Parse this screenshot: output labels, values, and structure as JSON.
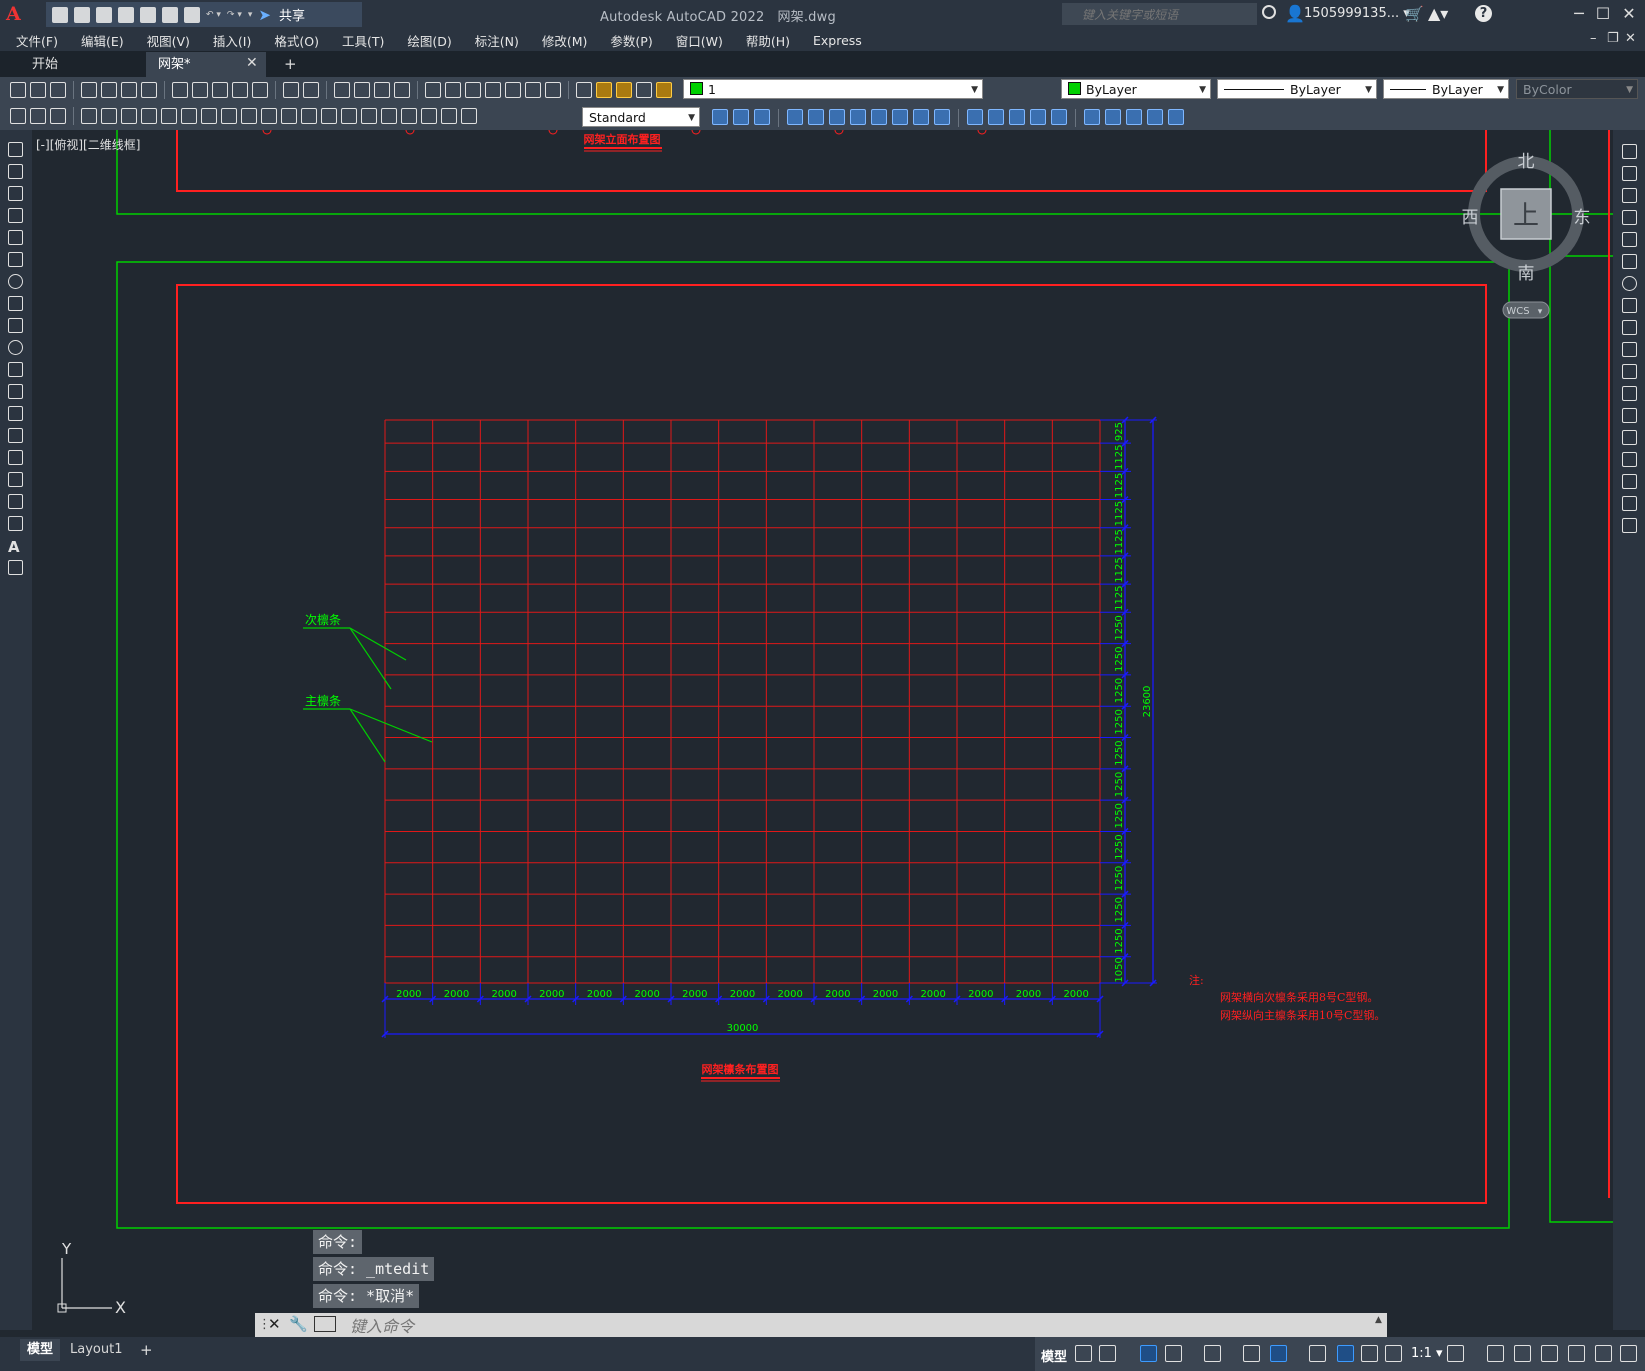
{
  "title_bar": {
    "app_logo": "A",
    "share_label": "共享",
    "app_title": "Autodesk AutoCAD 2022",
    "file_name": "网架.dwg",
    "search_placeholder": "键入关键字或短语",
    "user_name": "1505999135...",
    "help": "?"
  },
  "menu": [
    "文件(F)",
    "编辑(E)",
    "视图(V)",
    "插入(I)",
    "格式(O)",
    "工具(T)",
    "绘图(D)",
    "标注(N)",
    "修改(M)",
    "参数(P)",
    "窗口(W)",
    "帮助(H)",
    "Express"
  ],
  "tabs": {
    "start": "开始",
    "drawing": "网架*"
  },
  "toolbar": {
    "layer_name": "1",
    "color": "ByLayer",
    "linetype": "ByLayer",
    "lineweight": "ByLayer",
    "plotstyle": "ByColor",
    "text_style": "Standard"
  },
  "viewport_label": "[-][俯视][二维线框]",
  "viewcube": {
    "north": "北",
    "south": "南",
    "east": "东",
    "west": "西",
    "top": "上",
    "wcs": "WCS"
  },
  "ucs": {
    "x": "X",
    "y": "Y"
  },
  "drawing": {
    "upper_title": "网架立面布置图",
    "main_title": "网架檩条布置图",
    "label_secondary": "次檩条",
    "label_main": "主檩条",
    "col_dims": [
      "2000",
      "2000",
      "2000",
      "2000",
      "2000",
      "2000",
      "2000",
      "2000",
      "2000",
      "2000",
      "2000",
      "2000",
      "2000",
      "2000",
      "2000"
    ],
    "total_width": "30000",
    "row_dims": [
      "925",
      "1125",
      "1125",
      "1125",
      "1125",
      "1125",
      "1125",
      "1250",
      "1250",
      "1250",
      "1250",
      "1250",
      "1250",
      "1250",
      "1250",
      "1250",
      "1250",
      "1250",
      "1050"
    ],
    "total_height": "23600",
    "note_title": "注:",
    "note_line1": "网架横向次檩条采用8号C型钢。",
    "note_line2": "网架纵向主檩条采用10号C型钢。",
    "colors": {
      "frame": "#ff2020",
      "border": "#00d000",
      "dim_text": "#00ff00",
      "dim_line": "#1a1aff",
      "grid": "#e01818"
    }
  },
  "command": {
    "history": [
      "命令:",
      "命令: _mtedit",
      "命令: *取消*"
    ],
    "placeholder": "键入命令"
  },
  "status": {
    "model_tab": "模型",
    "layout_tab": "Layout1",
    "add": "+",
    "model_button": "模型",
    "scale": "1:1"
  }
}
